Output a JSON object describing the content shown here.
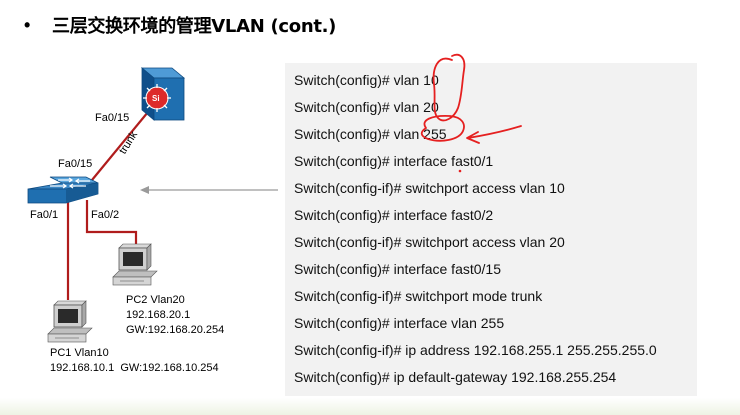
{
  "slide": {
    "bullet": "•",
    "title": "三层交换环境的管理VLAN (cont.)"
  },
  "diagram": {
    "l3_switch_logo": "Si",
    "port_l3": "Fa0/15",
    "link_label": "trunk",
    "port_l2_up": "Fa0/15",
    "port_l2_pc1": "Fa0/1",
    "port_l2_pc2": "Fa0/2",
    "pc2": {
      "name": "PC2 Vlan20",
      "ip": "192.168.20.1",
      "gw": "GW:192.168.20.254"
    },
    "pc1": {
      "name": "PC1 Vlan10",
      "addr_line": "192.168.10.1  GW:192.168.10.254"
    }
  },
  "commands": [
    "Switch(config)# vlan 10",
    "Switch(config)# vlan 20",
    "Switch(config)# vlan 255",
    "Switch(config)# interface fast0/1",
    "Switch(config-if)# switchport access vlan 10",
    "Switch(config)# interface fast0/2",
    "Switch(config-if)# switchport access vlan 20",
    "Switch(config)# interface fast0/15",
    "Switch(config-if)# switchport mode trunk",
    "Switch(config)# interface vlan 255",
    "Switch(config-if)# ip address 192.168.255.1 255.255.255.0",
    "Switch(config)# ip default-gateway 192.168.255.254"
  ],
  "colors": {
    "device_blue": "#1f6fb0",
    "link_red": "#b01c1c",
    "annotation_red": "#e52020",
    "panel_bg": "#f2f2f2",
    "arrow_gray": "#9a9a9a"
  },
  "icons": [
    "layer3-switch-icon",
    "layer2-switch-icon",
    "pc-icon",
    "pc-icon",
    "pointer-arrow-icon"
  ]
}
